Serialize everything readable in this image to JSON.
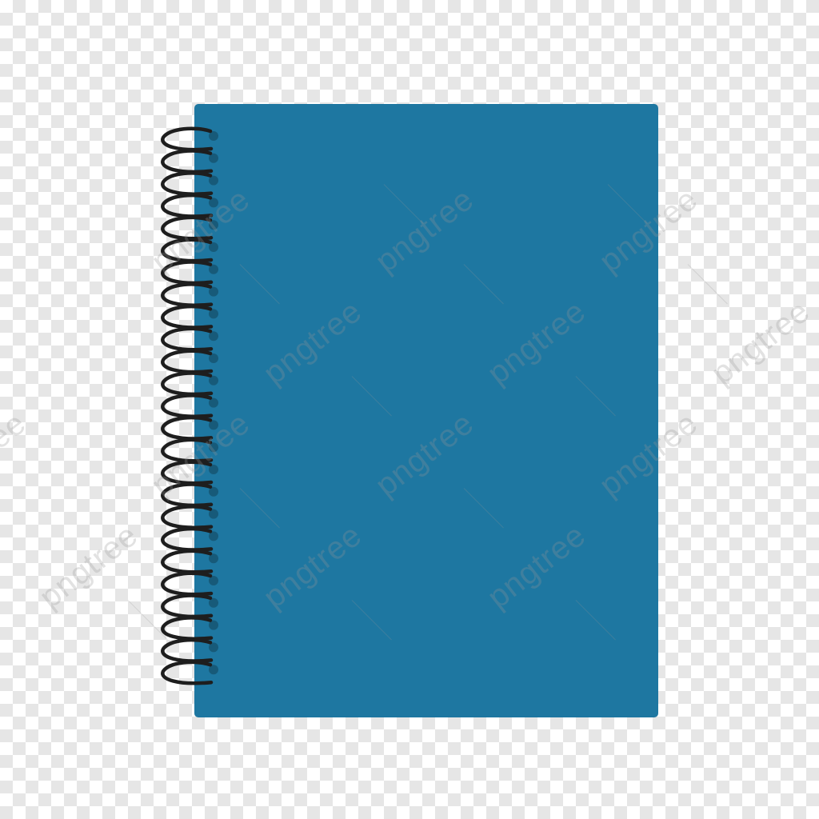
{
  "illustration": {
    "subject": "spiral-notebook-icon",
    "cover_color": "#1e77a1",
    "coil_color": "#1e1e1e",
    "hole_color": "#175a79",
    "background": "transparent-checkerboard"
  },
  "watermark": {
    "text": "pngtree"
  }
}
